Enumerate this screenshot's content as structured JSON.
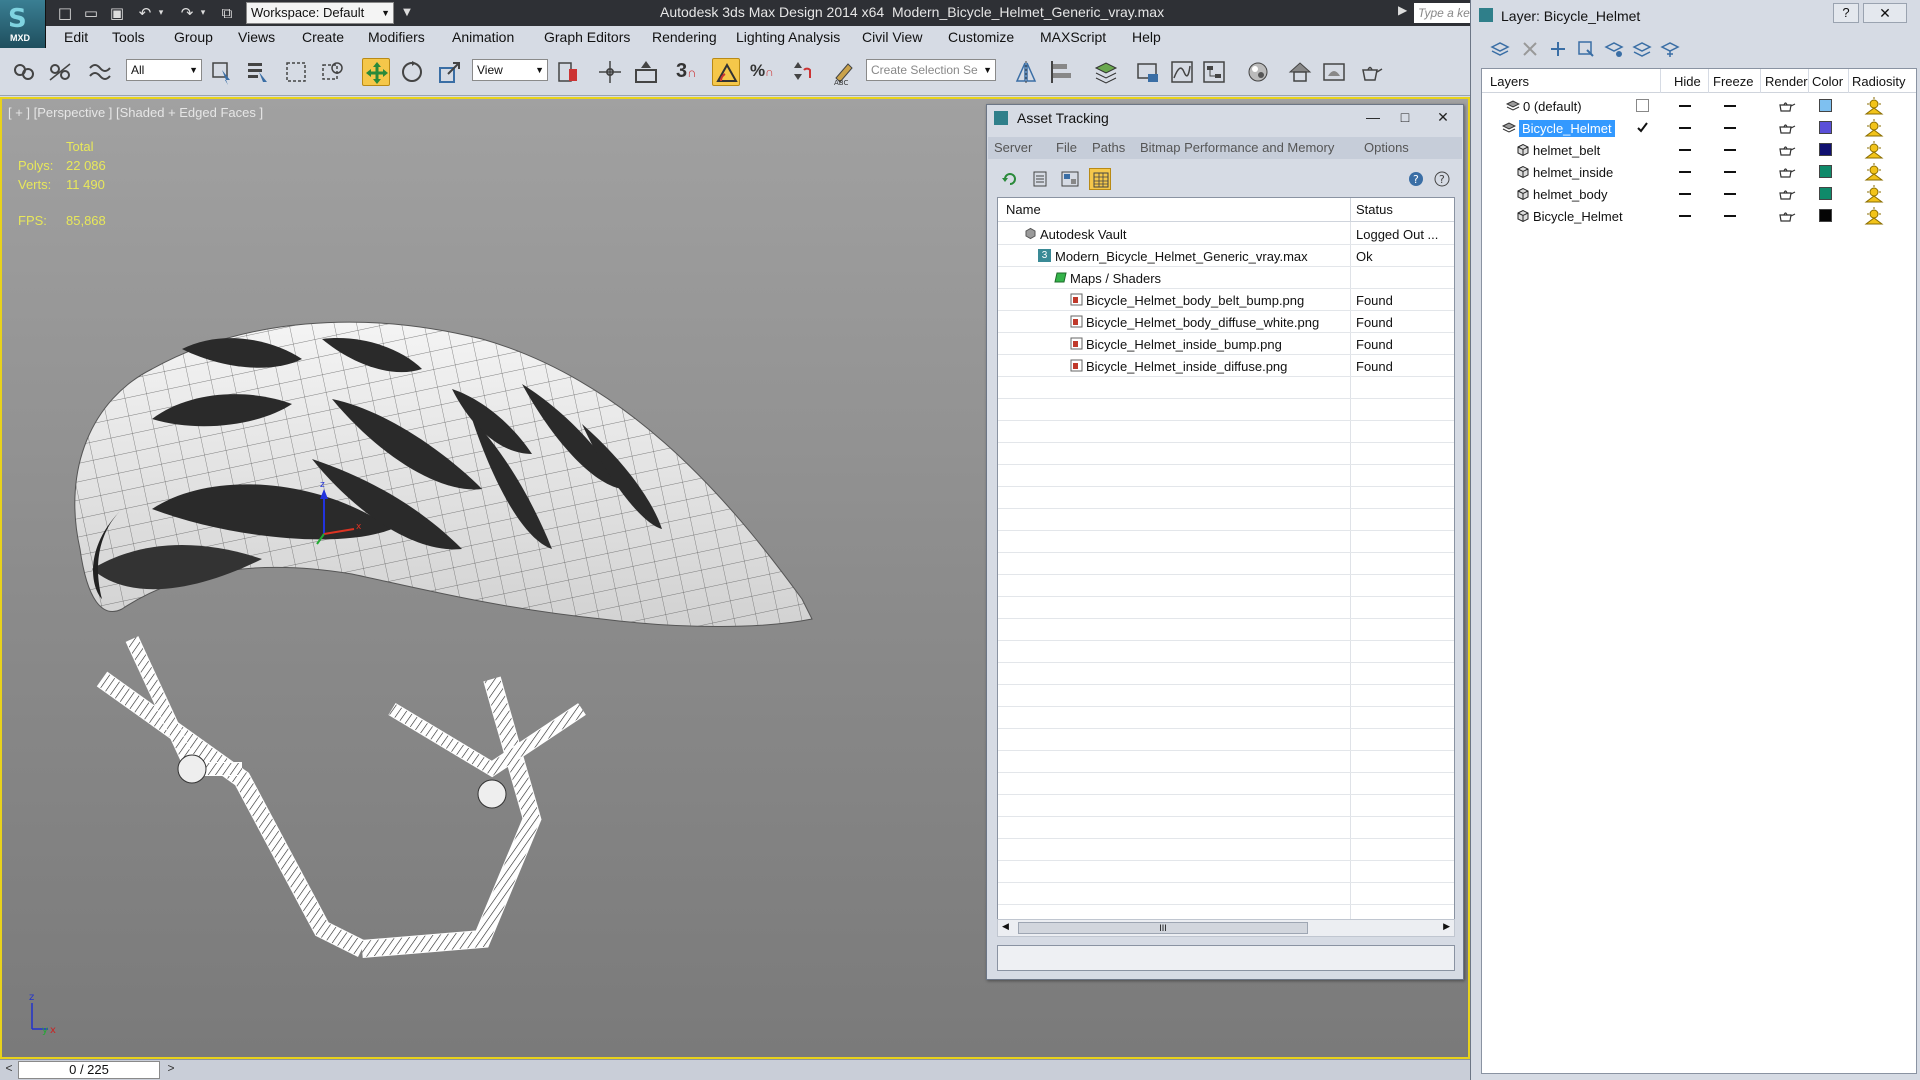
{
  "titlebar": {
    "app_logo": "MXD",
    "workspace": "Workspace: Default",
    "app_title": "Autodesk 3ds Max Design 2014 x64",
    "document": "Modern_Bicycle_Helmet_Generic_vray.max",
    "search_placeholder": "Type a ke"
  },
  "menu": [
    "Edit",
    "Tools",
    "Group",
    "Views",
    "Create",
    "Modifiers",
    "Animation",
    "Graph Editors",
    "Rendering",
    "Lighting Analysis",
    "Civil View",
    "Customize",
    "MAXScript",
    "Help"
  ],
  "toolbar": {
    "filter": "All",
    "ref_coord": "View",
    "snap_label": "3",
    "selection_set_placeholder": "Create Selection Se"
  },
  "viewport": {
    "label": "[ + ] [Perspective ] [Shaded + Edged Faces ]",
    "stats": {
      "header": "Total",
      "polys_label": "Polys:",
      "polys": "22 086",
      "verts_label": "Verts:",
      "verts": "11 490",
      "fps_label": "FPS:",
      "fps": "85,868"
    },
    "axis": {
      "z": "z",
      "x": "x",
      "y": "y"
    },
    "gizmo": {
      "z": "z",
      "x": "x"
    }
  },
  "timeline": {
    "prev": "<",
    "position": "0 / 225",
    "next": ">"
  },
  "asset_tracking": {
    "title": "Asset Tracking",
    "menu": [
      "Server",
      "File",
      "Paths",
      "Bitmap Performance and Memory",
      "Options"
    ],
    "columns": {
      "name": "Name",
      "status": "Status"
    },
    "rows": [
      {
        "name": "Autodesk Vault",
        "status": "Logged Out ..."
      },
      {
        "name": "Modern_Bicycle_Helmet_Generic_vray.max",
        "status": "Ok",
        "icon_label": "3"
      },
      {
        "name": "Maps / Shaders",
        "status": ""
      },
      {
        "name": "Bicycle_Helmet_body_belt_bump.png",
        "status": "Found"
      },
      {
        "name": "Bicycle_Helmet_body_diffuse_white.png",
        "status": "Found"
      },
      {
        "name": "Bicycle_Helmet_inside_bump.png",
        "status": "Found"
      },
      {
        "name": "Bicycle_Helmet_inside_diffuse.png",
        "status": "Found"
      }
    ],
    "scroll_grip": "III"
  },
  "layer_explorer": {
    "title": "Layer: Bicycle_Helmet",
    "help": "?",
    "columns": {
      "layers": "Layers",
      "hide": "Hide",
      "freeze": "Freeze",
      "render": "Render",
      "color": "Color",
      "radiosity": "Radiosity"
    },
    "rows": [
      {
        "name": "0 (default)",
        "color": "#7ec0f0"
      },
      {
        "name": "Bicycle_Helmet",
        "color": "#5a4fd8"
      },
      {
        "name": "helmet_belt",
        "color": "#101070"
      },
      {
        "name": "helmet_inside",
        "color": "#0f8a6a"
      },
      {
        "name": "helmet_body",
        "color": "#0f8a6a"
      },
      {
        "name": "Bicycle_Helmet",
        "color": "#050505"
      }
    ]
  }
}
